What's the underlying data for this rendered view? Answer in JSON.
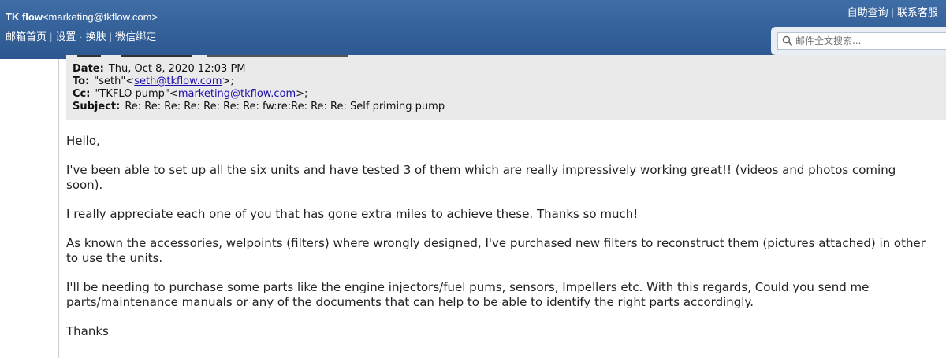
{
  "topbar": {
    "brand_name": "TK flow",
    "brand_email": "<marketing@tkflow.com>",
    "nav": [
      "邮箱首页",
      "设置",
      "换肤",
      "微信绑定"
    ],
    "right_links": [
      "自助查询",
      "联系客服"
    ],
    "search_placeholder": "邮件全文搜索..."
  },
  "email_header": {
    "date_label": "Date:",
    "date_value": "Thu, Oct 8, 2020 12:03 PM",
    "to_label": "To:",
    "to_name": "\"seth\"",
    "to_email": "seth@tkflow.com",
    "cc_label": "Cc:",
    "cc_name": "\"TKFLO pump\"",
    "cc_email": "marketing@tkflow.com",
    "subject_label": "Subject:",
    "subject_value": "Re: Re: Re: Re: Re: Re: Re: fw:re:Re: Re: Re: Self priming pump"
  },
  "email_body": {
    "paragraphs": [
      "Hello,",
      "I've been able to set up all the six units and have tested 3 of them which are really impressively working great!! (videos and photos coming soon).",
      "I really appreciate each one of you that has gone extra miles to achieve these. Thanks so much!",
      "As known the accessories, welpoints (filters) where wrongly designed, I've purchased new filters to reconstruct them (pictures attached) in other to use the units.",
      "I'll be needing to purchase some parts like the engine injectors/fuel pums, sensors, Impellers etc. With this regards, Could you send me parts/maintenance manuals or any of the documents that can help to be able to identify the right parts accordingly.",
      "Thanks"
    ]
  }
}
